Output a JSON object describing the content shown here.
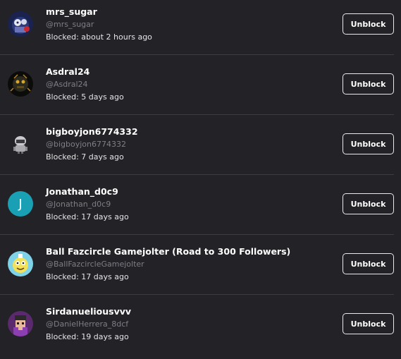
{
  "blocked_users": [
    {
      "name": "mrs_sugar",
      "handle": "@mrs_sugar",
      "blocked": "Blocked: about 2 hours ago",
      "avatar": "mrs-sugar-avatar"
    },
    {
      "name": "Asdral24",
      "handle": "@Asdral24",
      "blocked": "Blocked: 5 days ago",
      "avatar": "asdral-avatar"
    },
    {
      "name": "bigboyjon6774332",
      "handle": "@bigboyjon6774332",
      "blocked": "Blocked: 7 days ago",
      "avatar": "robot-avatar"
    },
    {
      "name": "Jonathan_d0c9",
      "handle": "@Jonathan_d0c9",
      "blocked": "Blocked: 17 days ago",
      "avatar": "letter-avatar",
      "letter": "J"
    },
    {
      "name": "Ball Fazcircle Gamejolter (Road to 300 Followers)",
      "handle": "@BallFazcircleGamejolter",
      "blocked": "Blocked: 17 days ago",
      "avatar": "cartoon-avatar"
    },
    {
      "name": "Sirdanueliousvvv",
      "handle": "@DanielHerrera_8dcf",
      "blocked": "Blocked: 19 days ago",
      "avatar": "pixel-avatar"
    }
  ],
  "unblock_label": "Unblock",
  "colors": {
    "background": "#232227",
    "divider": "#3d3c42",
    "handle_text": "#7f7e85",
    "letter_avatar": "#1aa0b5"
  }
}
